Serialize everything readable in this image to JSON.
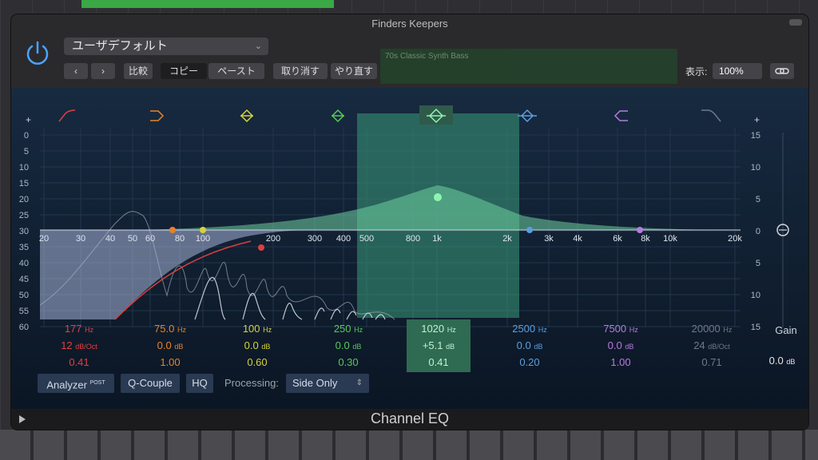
{
  "window": {
    "title": "Finders Keepers",
    "plugin_name": "Channel EQ"
  },
  "toolbar": {
    "preset": "ユーザデフォルト",
    "compare": "比較",
    "copy": "コピー",
    "paste": "ペースト",
    "undo": "取り消す",
    "redo": "やり直す",
    "view_label": "表示:",
    "zoom": "100%",
    "region_label": "70s Classic Synth Bass"
  },
  "graph": {
    "plus": "+",
    "db_left": [
      "0",
      "5",
      "10",
      "15",
      "20",
      "25",
      "30",
      "35",
      "40",
      "45",
      "50",
      "55",
      "60"
    ],
    "db_right": [
      "15",
      "10",
      "5",
      "0",
      "5",
      "10",
      "15"
    ],
    "freq_labels": [
      "20",
      "30",
      "40",
      "50",
      "60",
      "80",
      "100",
      "200",
      "300",
      "400",
      "500",
      "800",
      "1k",
      "2k",
      "3k",
      "4k",
      "6k",
      "8k",
      "10k",
      "20k"
    ]
  },
  "bands": [
    {
      "freq": "177",
      "unit": "Hz",
      "gain": "12",
      "gain_unit": "dB/Oct",
      "q": "0.41",
      "color": "#e04040"
    },
    {
      "freq": "75.0",
      "unit": "Hz",
      "gain": "0.0",
      "gain_unit": "dB",
      "q": "1.00",
      "color": "#e8822a"
    },
    {
      "freq": "100",
      "unit": "Hz",
      "gain": "0.0",
      "gain_unit": "dB",
      "q": "0.60",
      "color": "#d7d23a"
    },
    {
      "freq": "250",
      "unit": "Hz",
      "gain": "0.0",
      "gain_unit": "dB",
      "q": "0.30",
      "color": "#58c95a"
    },
    {
      "freq": "1020",
      "unit": "Hz",
      "gain": "+5.1",
      "gain_unit": "dB",
      "q": "0.41",
      "color": "#7de39a"
    },
    {
      "freq": "2500",
      "unit": "Hz",
      "gain": "0.0",
      "gain_unit": "dB",
      "q": "0.20",
      "color": "#5a9fe0"
    },
    {
      "freq": "7500",
      "unit": "Hz",
      "gain": "0.0",
      "gain_unit": "dB",
      "q": "1.00",
      "color": "#b87ae0"
    },
    {
      "freq": "20000",
      "unit": "Hz",
      "gain": "24",
      "gain_unit": "dB/Oct",
      "q": "0.71",
      "color": "#6e7a88"
    }
  ],
  "gain": {
    "label": "Gain",
    "value": "0.0",
    "unit": "dB"
  },
  "controls": {
    "analyzer": "Analyzer",
    "analyzer_sup": "POST",
    "qcouple": "Q-Couple",
    "hq": "HQ",
    "processing_label": "Processing:",
    "processing_value": "Side Only"
  }
}
